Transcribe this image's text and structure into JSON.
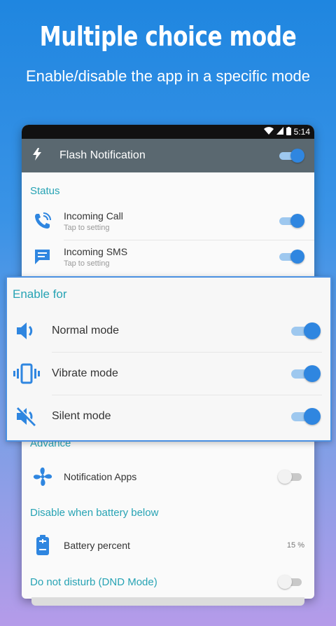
{
  "promo": {
    "headline": "Multiple choice mode",
    "subheadline": "Enable/disable the app in a specific mode"
  },
  "statusbar": {
    "time": "5:14"
  },
  "appbar": {
    "title": "Flash Notification",
    "enabled": true
  },
  "status_section": {
    "label": "Status",
    "items": [
      {
        "title": "Incoming Call",
        "subtitle": "Tap to setting",
        "enabled": true
      },
      {
        "title": "Incoming SMS",
        "subtitle": "Tap to setting",
        "enabled": true
      }
    ]
  },
  "enable_for": {
    "label": "Enable for",
    "items": [
      {
        "title": "Normal mode",
        "enabled": true
      },
      {
        "title": "Vibrate mode",
        "enabled": true
      },
      {
        "title": "Silent mode",
        "enabled": true
      }
    ]
  },
  "advance_section": {
    "label": "Advance",
    "items": [
      {
        "title": "Notification Apps",
        "enabled": false
      }
    ]
  },
  "battery_section": {
    "label": "Disable when battery below",
    "item": {
      "title": "Battery percent",
      "value": "15 %"
    }
  },
  "dnd_section": {
    "label": "Do not disturb (DND Mode)",
    "enabled": false
  },
  "colors": {
    "accent": "#2f86e0",
    "section_label": "#27a3b4",
    "appbar": "#5a6870"
  }
}
